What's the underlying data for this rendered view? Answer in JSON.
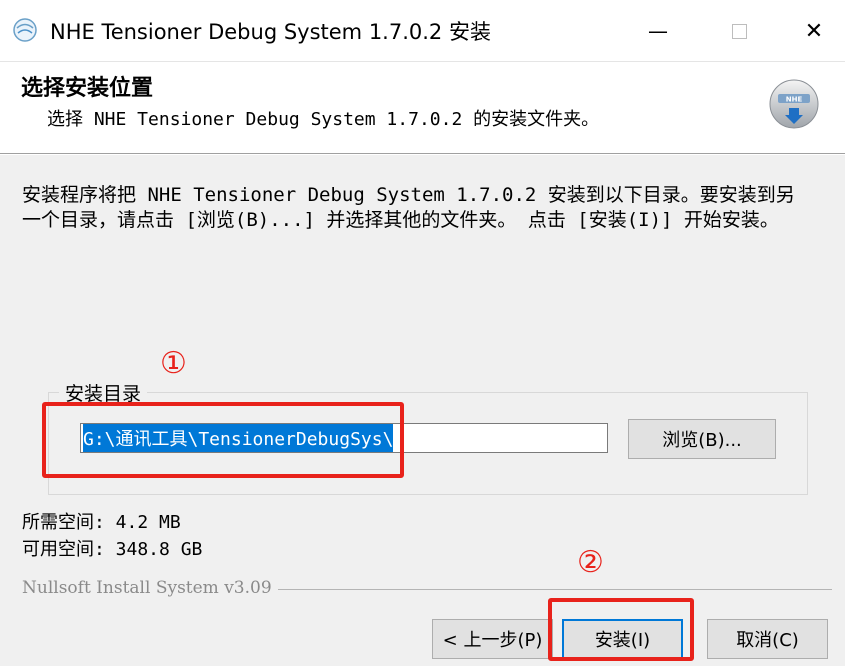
{
  "window": {
    "title": "NHE Tensioner Debug System 1.7.0.2 安装",
    "minimize_glyph": "—",
    "close_glyph": "✕"
  },
  "header": {
    "title": "选择安装位置",
    "subtitle": "选择 NHE Tensioner Debug System 1.7.0.2 的安装文件夹。",
    "logo_text": "NHE"
  },
  "body": {
    "description": "安装程序将把 NHE Tensioner Debug System 1.7.0.2 安装到以下目录。要安装到另一个目录，请点击 [浏览(B)...] 并选择其他的文件夹。 点击 [安装(I)] 开始安装。",
    "group_label": "安装目录",
    "install_path": "G:\\通讯工具\\TensionerDebugSys\\",
    "browse_label": "浏览(B)...",
    "space_required": "所需空间: 4.2 MB",
    "space_available": "可用空间: 348.8 GB",
    "branding": "Nullsoft Install System v3.09"
  },
  "footer": {
    "back_label": "< 上一步(P)",
    "install_label": "安装(I)",
    "cancel_label": "取消(C)"
  },
  "annotations": {
    "marker_1": "①",
    "marker_2": "②",
    "color": "#e8221b"
  },
  "colors": {
    "accent": "#0078d7",
    "dialog_bg": "#f0f0f0"
  }
}
